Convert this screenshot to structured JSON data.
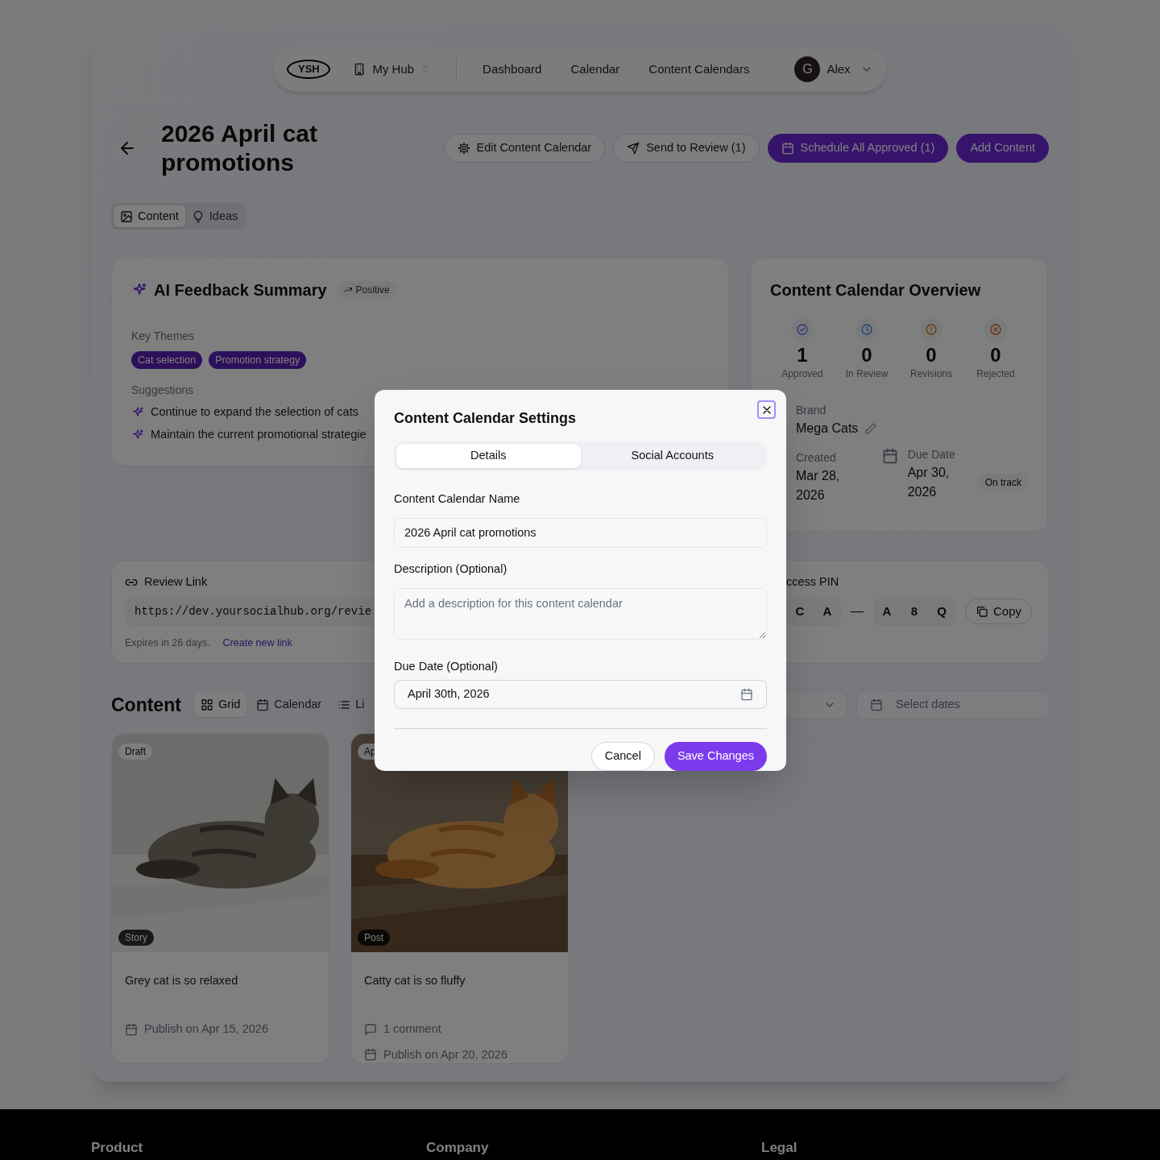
{
  "nav": {
    "logo": "YSH",
    "hub": "My Hub",
    "links": [
      {
        "label": "Dashboard"
      },
      {
        "label": "Calendar"
      },
      {
        "label": "Content Calendars"
      }
    ],
    "user": {
      "initial": "G",
      "name": "Alex"
    }
  },
  "header": {
    "title": "2026 April cat promotions",
    "actions": [
      {
        "label": "Edit Content Calendar",
        "kind": "outline"
      },
      {
        "label": "Send to Review (1)",
        "kind": "outline"
      },
      {
        "label": "Schedule All Approved (1)",
        "kind": "primary"
      },
      {
        "label": "Add Content",
        "kind": "primary"
      }
    ]
  },
  "page_tabs": [
    {
      "label": "Content",
      "selected": true
    },
    {
      "label": "Ideas",
      "selected": false
    }
  ],
  "feedback": {
    "title": "AI Feedback Summary",
    "sentiment": "Positive",
    "themes_label": "Key Themes",
    "themes": [
      "Cat selection",
      "Promotion strategy"
    ],
    "suggestions_label": "Suggestions",
    "suggestions": [
      "Continue to expand the selection of cats",
      "Maintain the current promotional strategie"
    ]
  },
  "overview": {
    "title": "Content Calendar Overview",
    "stats": [
      {
        "kind": "approved",
        "value": "1",
        "label": "Approved"
      },
      {
        "kind": "review",
        "value": "0",
        "label": "In Review"
      },
      {
        "kind": "revisions",
        "value": "0",
        "label": "Revisions"
      },
      {
        "kind": "rejected",
        "value": "0",
        "label": "Rejected"
      }
    ],
    "brand_label": "Brand",
    "brand": "Mega Cats",
    "created_label": "Created",
    "created": "Mar 28, 2026",
    "due_label": "Due Date",
    "due": "Apr 30, 2026",
    "due_status": "On track"
  },
  "review": {
    "title": "Review Link",
    "url": "https://dev.yoursocialhub.org/revie",
    "expires": "Expires in 26 days.",
    "new_link": "Create new link",
    "pin_label": "ccess PIN",
    "pin_groups": [
      [
        "C",
        "A"
      ],
      [
        "A",
        "8",
        "Q"
      ]
    ],
    "separator": "—",
    "copy": "Copy"
  },
  "content": {
    "title": "Content",
    "views": [
      {
        "label": "Grid",
        "selected": true
      },
      {
        "label": "Calendar",
        "selected": false
      },
      {
        "label": "Li",
        "selected": false
      }
    ],
    "date_filter": {
      "placeholder": "Select dates"
    },
    "items": [
      {
        "status": "Draft",
        "type": "Story",
        "title": "Grey cat is so relaxed",
        "publish": "Publish on Apr 15, 2026"
      },
      {
        "status": "Ap",
        "type": "Post",
        "title": "Catty cat is so fluffy",
        "comments": "1 comment",
        "publish": "Publish on Apr 20, 2026"
      }
    ]
  },
  "footer": {
    "columns": [
      "Product",
      "Company",
      "Legal"
    ]
  },
  "dialog": {
    "title": "Content Calendar Settings",
    "tabs": [
      {
        "label": "Details",
        "selected": true
      },
      {
        "label": "Social Accounts",
        "selected": false
      }
    ],
    "fields": [
      {
        "kind": "text",
        "label": "Content Calendar Name",
        "value": "2026 April cat promotions"
      },
      {
        "kind": "textarea",
        "label": "Description (Optional)",
        "placeholder": "Add a description for this content calendar"
      },
      {
        "kind": "date",
        "label": "Due Date (Optional)",
        "value": "April 30th, 2026"
      }
    ],
    "cancel": "Cancel",
    "save": "Save Changes"
  }
}
